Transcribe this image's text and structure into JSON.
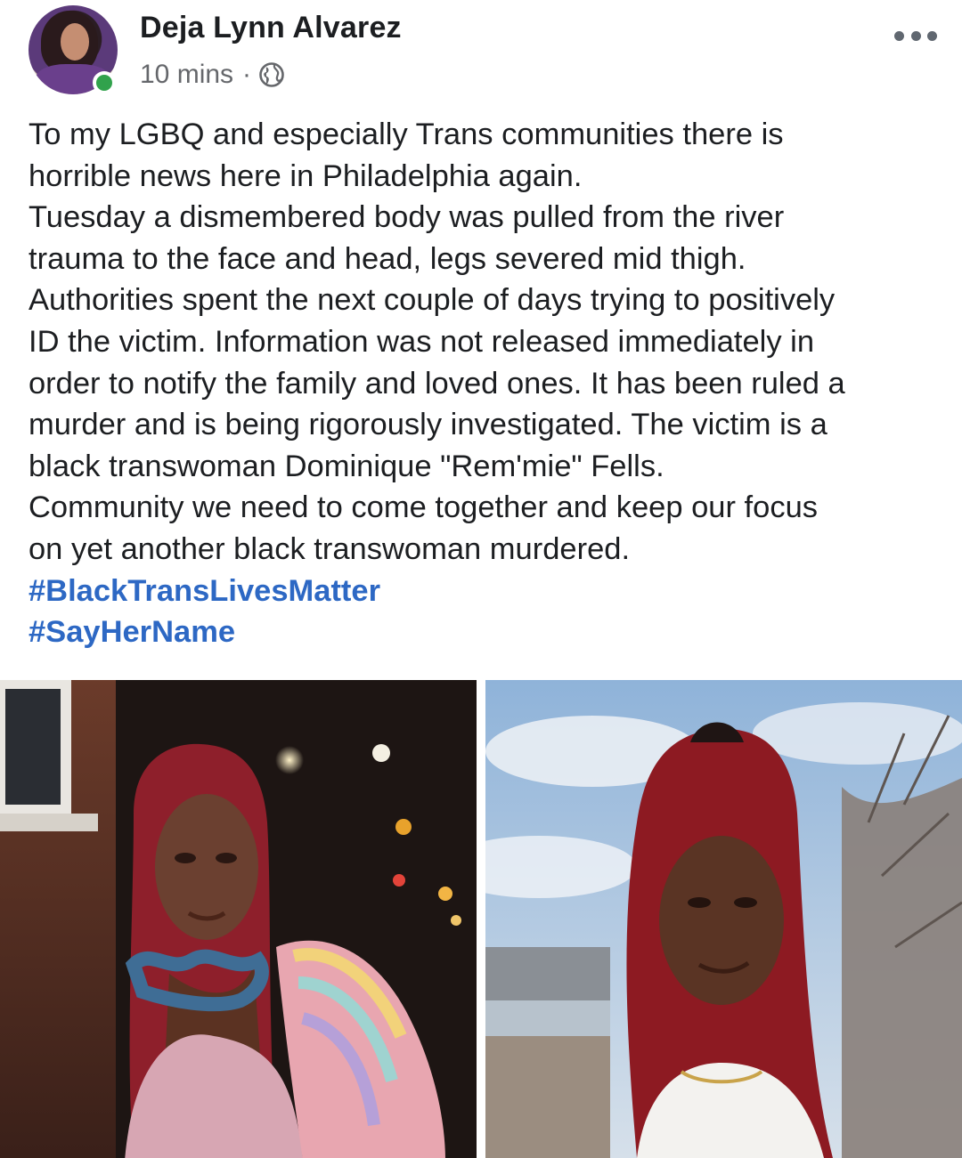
{
  "post": {
    "author": "Deja Lynn Alvarez",
    "timestamp": "10 mins",
    "separator": "·",
    "privacy_icon": "globe-icon",
    "more_icon": "more-options-icon",
    "body_lines": [
      "To my LGBQ and especially Trans communities there is",
      "horrible news here in Philadelphia again.",
      "Tuesday a dismembered body was pulled from the river",
      "trauma to the face and head, legs severed mid thigh.",
      "Authorities spent the next couple of days trying to positively",
      "ID the victim. Information was not released immediately in",
      "order to notify the family and loved ones. It has been ruled a",
      "murder and is being rigorously investigated. The victim is a",
      "black transwoman  Dominique \"Rem'mie\" Fells.",
      "Community we need to come together and keep our focus",
      "on yet another black transwoman murdered."
    ],
    "hashtags": [
      "#BlackTransLivesMatter",
      "#SayHerName"
    ]
  },
  "colors": {
    "hashtag": "#2d68c4",
    "online": "#31a24c",
    "meta_text": "#65676b"
  }
}
